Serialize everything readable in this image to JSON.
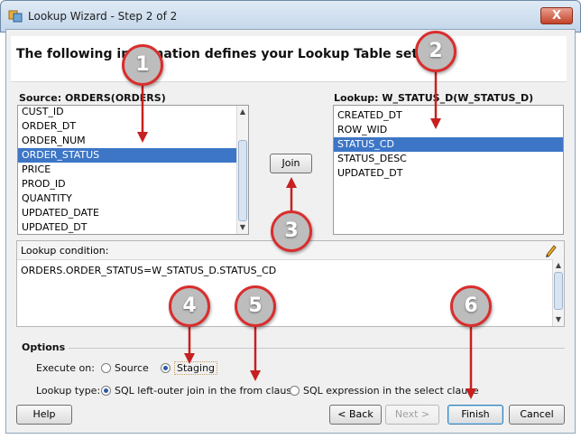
{
  "window": {
    "title": "Lookup Wizard - Step 2 of 2",
    "close_glyph": "X"
  },
  "heading": "The following information defines your Lookup Table settings",
  "source": {
    "label": "Source: ORDERS(ORDERS)",
    "items": [
      "CUST_ID",
      "ORDER_DT",
      "ORDER_NUM",
      "ORDER_STATUS",
      "PRICE",
      "PROD_ID",
      "QUANTITY",
      "UPDATED_DATE",
      "UPDATED_DT"
    ],
    "selected": "ORDER_STATUS"
  },
  "lookup": {
    "label": "Lookup: W_STATUS_D(W_STATUS_D)",
    "items": [
      "CREATED_DT",
      "ROW_WID",
      "STATUS_CD",
      "STATUS_DESC",
      "UPDATED_DT"
    ],
    "selected": "STATUS_CD"
  },
  "join_button": "Join",
  "condition": {
    "label": "Lookup condition:",
    "value": "ORDERS.ORDER_STATUS=W_STATUS_D.STATUS_CD"
  },
  "options": {
    "title": "Options",
    "execute_on_label": "Execute on:",
    "execute_on": [
      "Source",
      "Staging"
    ],
    "execute_on_selected": "Staging",
    "lookup_type_label": "Lookup type:",
    "lookup_type": [
      "SQL left-outer join in the from clause",
      "SQL expression in the select clause"
    ],
    "lookup_type_selected": "SQL left-outer join in the from clause"
  },
  "buttons": {
    "help": "Help",
    "back": "< Back",
    "next": "Next >",
    "finish": "Finish",
    "cancel": "Cancel"
  },
  "callouts": [
    "1",
    "2",
    "3",
    "4",
    "5",
    "6"
  ],
  "colors": {
    "selection": "#3d76c6",
    "callout_ring": "#d92e2e",
    "arrow": "#c62020"
  }
}
